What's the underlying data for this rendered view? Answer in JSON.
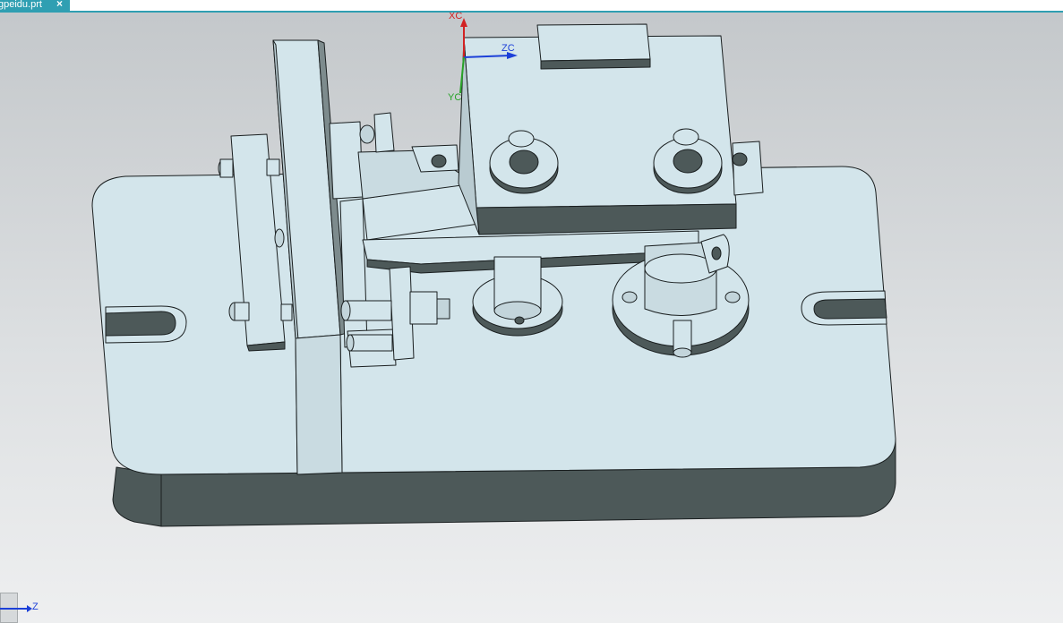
{
  "tab": {
    "file_name": "gpeidu.prt",
    "close_symbol": "×"
  },
  "wcs": {
    "x_label": "XC",
    "y_label": "YC",
    "z_label": "ZC"
  },
  "view_triad": {
    "z_label": "Z"
  },
  "colors": {
    "part_top": "#d3e5eb",
    "part_side": "#4d5959",
    "edge": "#1a1f20",
    "x_axis": "#d22222",
    "y_axis": "#29a329",
    "z_axis": "#1c40d8",
    "tab_bg": "#2f9fb2"
  },
  "icons": [
    "close-icon",
    "wcs-triad",
    "view-triad-z-arrow"
  ]
}
